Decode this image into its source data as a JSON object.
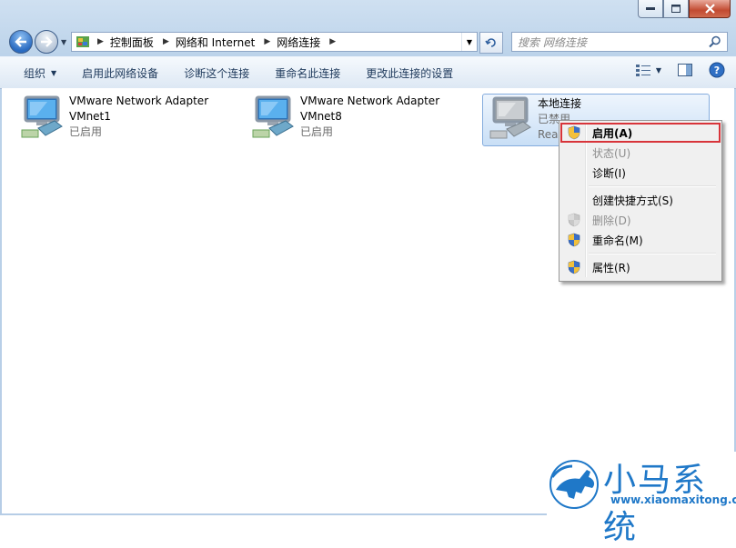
{
  "window": {
    "min_glyph": "▬",
    "max_glyph": "□",
    "close_glyph": "✕"
  },
  "address": {
    "breadcrumbs": [
      "控制面板",
      "网络和 Internet",
      "网络连接"
    ],
    "search_placeholder": "搜索 网络连接"
  },
  "toolbar": {
    "organize": "组织",
    "enable_device": "启用此网络设备",
    "diagnose": "诊断这个连接",
    "rename": "重命名此连接",
    "change_settings": "更改此连接的设置"
  },
  "connections": [
    {
      "name": "VMware Network Adapter",
      "sub": "VMnet1",
      "status": "已启用"
    },
    {
      "name": "VMware Network Adapter",
      "sub": "VMnet8",
      "status": "已启用"
    },
    {
      "name": "本地连接",
      "sub": "已禁用",
      "status": "Realt"
    }
  ],
  "context_menu": {
    "items": [
      {
        "label": "启用(A)",
        "icon": "shield-icon",
        "state": "default"
      },
      {
        "label": "状态(U)",
        "icon": "",
        "state": "disabled"
      },
      {
        "label": "诊断(I)",
        "icon": "",
        "state": "normal"
      },
      {
        "label": "创建快捷方式(S)",
        "icon": "",
        "state": "normal"
      },
      {
        "label": "删除(D)",
        "icon": "shield-icon",
        "state": "disabled"
      },
      {
        "label": "重命名(M)",
        "icon": "shield-icon",
        "state": "normal"
      },
      {
        "label": "属性(R)",
        "icon": "shield-icon",
        "state": "normal"
      }
    ]
  },
  "watermark": {
    "title": "小马系统",
    "url": "www.xiaomaxitong.com"
  },
  "colors": {
    "accent": "#1f78c8",
    "highlight_border": "#d8343a",
    "toolbar_text": "#1e395b"
  }
}
